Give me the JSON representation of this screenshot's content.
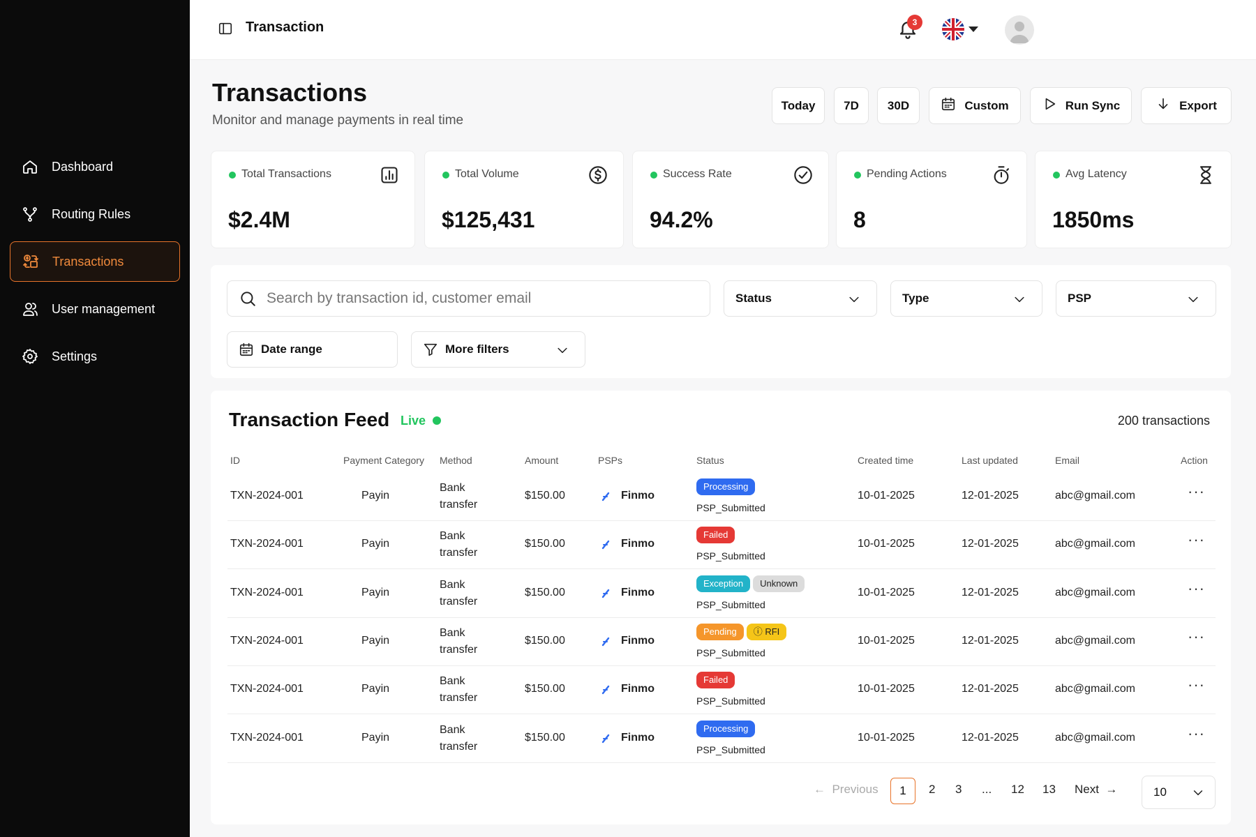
{
  "sidebar": {
    "items": [
      {
        "label": "Dashboard",
        "icon": "home-icon"
      },
      {
        "label": "Routing Rules",
        "icon": "routing-icon"
      },
      {
        "label": "Transactions",
        "icon": "transactions-icon",
        "active": true
      },
      {
        "label": "User management",
        "icon": "users-icon"
      },
      {
        "label": "Settings",
        "icon": "gear-icon"
      }
    ],
    "active_color": "#e8742a"
  },
  "topbar": {
    "breadcrumb": "Transaction",
    "notification_count": "3"
  },
  "header": {
    "title": "Transactions",
    "subtitle": "Monitor and manage payments in real time",
    "buttons": {
      "today": "Today",
      "d7": "7D",
      "d30": "30D",
      "custom": "Custom",
      "run_sync": "Run Sync",
      "export": "Export"
    }
  },
  "stats": [
    {
      "label": "Total Transactions",
      "value": "$2.4M",
      "icon": "bar-chart-icon"
    },
    {
      "label": "Total Volume",
      "value": "$125,431",
      "icon": "dollar-icon"
    },
    {
      "label": "Success Rate",
      "value": "94.2%",
      "icon": "check-circle-icon"
    },
    {
      "label": "Pending Actions",
      "value": "8",
      "icon": "timer-icon"
    },
    {
      "label": "Avg Latency",
      "value": "1850ms",
      "icon": "hourglass-icon"
    }
  ],
  "filters": {
    "search_placeholder": "Search by transaction id, customer email",
    "status": "Status",
    "type": "Type",
    "psp": "PSP",
    "date_range": "Date range",
    "more_filters": "More filters"
  },
  "feed": {
    "title": "Transaction Feed",
    "live_label": "Live",
    "count": "200 transactions",
    "columns": [
      "ID",
      "Payment Category",
      "Method",
      "Amount",
      "PSPs",
      "Status",
      "Created time",
      "Last updated",
      "Email",
      "Action"
    ],
    "rows": [
      {
        "id": "TXN-2024-001",
        "category": "Payin",
        "method1": "Bank",
        "method2": "transfer",
        "amount": "$150.00",
        "psp": "Finmo",
        "statuses": [
          {
            "text": "Processing",
            "color": "#2f6bf0"
          }
        ],
        "sub": "PSP_Submitted",
        "created": "10-01-2025",
        "updated": "12-01-2025",
        "email": "abc@gmail.com"
      },
      {
        "id": "TXN-2024-001",
        "category": "Payin",
        "method1": "Bank",
        "method2": "transfer",
        "amount": "$150.00",
        "psp": "Finmo",
        "statuses": [
          {
            "text": "Failed",
            "color": "#e53935"
          }
        ],
        "sub": "PSP_Submitted",
        "created": "10-01-2025",
        "updated": "12-01-2025",
        "email": "abc@gmail.com"
      },
      {
        "id": "TXN-2024-001",
        "category": "Payin",
        "method1": "Bank",
        "method2": "transfer",
        "amount": "$150.00",
        "psp": "Finmo",
        "statuses": [
          {
            "text": "Exception",
            "color": "#22b3c9"
          },
          {
            "text": "Unknown",
            "color": "#dcdcdc",
            "fg": "#222"
          }
        ],
        "sub": "PSP_Submitted",
        "created": "10-01-2025",
        "updated": "12-01-2025",
        "email": "abc@gmail.com"
      },
      {
        "id": "TXN-2024-001",
        "category": "Payin",
        "method1": "Bank",
        "method2": "transfer",
        "amount": "$150.00",
        "psp": "Finmo",
        "statuses": [
          {
            "text": "Pending",
            "color": "#f5962b"
          },
          {
            "text": "ⓘ RFI",
            "color": "#f5c518",
            "fg": "#222"
          }
        ],
        "sub": "PSP_Submitted",
        "created": "10-01-2025",
        "updated": "12-01-2025",
        "email": "abc@gmail.com"
      },
      {
        "id": "TXN-2024-001",
        "category": "Payin",
        "method1": "Bank",
        "method2": "transfer",
        "amount": "$150.00",
        "psp": "Finmo",
        "statuses": [
          {
            "text": "Failed",
            "color": "#e53935"
          }
        ],
        "sub": "PSP_Submitted",
        "created": "10-01-2025",
        "updated": "12-01-2025",
        "email": "abc@gmail.com"
      },
      {
        "id": "TXN-2024-001",
        "category": "Payin",
        "method1": "Bank",
        "method2": "transfer",
        "amount": "$150.00",
        "psp": "Finmo",
        "statuses": [
          {
            "text": "Processing",
            "color": "#2f6bf0"
          }
        ],
        "sub": "PSP_Submitted",
        "created": "10-01-2025",
        "updated": "12-01-2025",
        "email": "abc@gmail.com"
      }
    ],
    "action_glyph": "···"
  },
  "pagination": {
    "previous": "Previous",
    "pages": [
      "1",
      "2",
      "3",
      "...",
      "12",
      "13"
    ],
    "next": "Next",
    "per_page": "10"
  }
}
